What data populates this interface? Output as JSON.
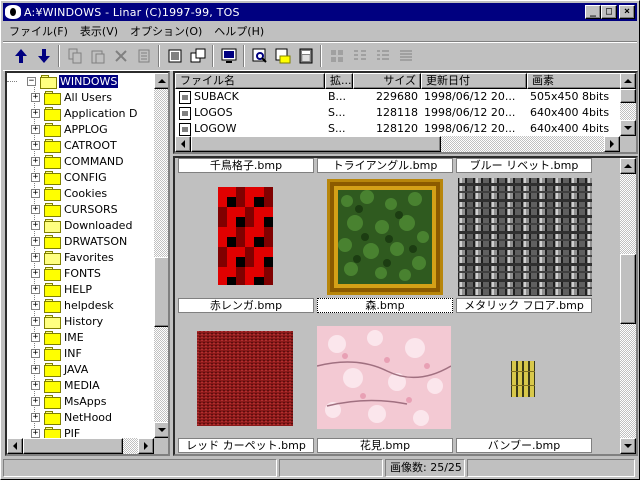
{
  "window": {
    "title": "A:¥WINDOWS - Linar (C)1997-99, TOS",
    "minimize": "_",
    "maximize": "□",
    "close": "×"
  },
  "menu": [
    {
      "label": "ファイル(F)"
    },
    {
      "label": "表示(V)"
    },
    {
      "label": "オプション(O)"
    },
    {
      "label": "ヘルプ(H)"
    }
  ],
  "toolbar": {
    "buttons": [
      {
        "name": "up-arrow-icon",
        "enabled": true
      },
      {
        "name": "down-arrow-icon",
        "enabled": true
      },
      {
        "name": "copy-icon",
        "enabled": false
      },
      {
        "name": "paste-icon",
        "enabled": false
      },
      {
        "name": "delete-icon",
        "enabled": false
      },
      {
        "name": "properties-icon",
        "enabled": false
      },
      {
        "name": "refresh-icon",
        "enabled": true
      },
      {
        "name": "new-window-icon",
        "enabled": true
      },
      {
        "name": "view-icon",
        "enabled": true
      },
      {
        "name": "find-icon",
        "enabled": true
      },
      {
        "name": "open-folder-icon",
        "enabled": true
      },
      {
        "name": "calculator-icon",
        "enabled": true
      },
      {
        "name": "large-icons-view-icon",
        "enabled": false
      },
      {
        "name": "small-icons-view-icon",
        "enabled": false
      },
      {
        "name": "list-view-icon",
        "enabled": false
      },
      {
        "name": "details-view-icon",
        "enabled": false
      }
    ]
  },
  "tree": {
    "root": "WINDOWS",
    "items": [
      {
        "label": "All Users",
        "icon": "folder"
      },
      {
        "label": "Application D",
        "icon": "folder"
      },
      {
        "label": "APPLOG",
        "icon": "folder"
      },
      {
        "label": "CATROOT",
        "icon": "folder"
      },
      {
        "label": "COMMAND",
        "icon": "folder"
      },
      {
        "label": "CONFIG",
        "icon": "folder"
      },
      {
        "label": "Cookies",
        "icon": "folder"
      },
      {
        "label": "CURSORS",
        "icon": "folder"
      },
      {
        "label": "Downloaded",
        "icon": "folder-special"
      },
      {
        "label": "DRWATSON",
        "icon": "folder"
      },
      {
        "label": "Favorites",
        "icon": "folder-special"
      },
      {
        "label": "FONTS",
        "icon": "folder"
      },
      {
        "label": "HELP",
        "icon": "folder"
      },
      {
        "label": "helpdesk",
        "icon": "folder"
      },
      {
        "label": "History",
        "icon": "folder-special"
      },
      {
        "label": "IME",
        "icon": "folder"
      },
      {
        "label": "INF",
        "icon": "folder"
      },
      {
        "label": "JAVA",
        "icon": "folder"
      },
      {
        "label": "MEDIA",
        "icon": "folder"
      },
      {
        "label": "MsApps",
        "icon": "folder"
      },
      {
        "label": "NetHood",
        "icon": "folder"
      },
      {
        "label": "PIF",
        "icon": "folder"
      }
    ]
  },
  "file_list": {
    "columns": [
      "ファイル名",
      "拡...",
      "サイズ",
      "更新日付",
      "画素"
    ],
    "rows": [
      {
        "name": "SUBACK",
        "ext": "B...",
        "size": "229680",
        "date": "1998/06/12 20...",
        "pixels": "505x450 8bits"
      },
      {
        "name": "LOGOS",
        "ext": "S...",
        "size": "128118",
        "date": "1998/06/12 20...",
        "pixels": "640x400 4bits"
      },
      {
        "name": "LOGOW",
        "ext": "S...",
        "size": "128120",
        "date": "1998/06/12 20...",
        "pixels": "640x400 4bits"
      }
    ]
  },
  "gallery": {
    "top_captions": [
      "千鳥格子.bmp",
      "トライアングル.bmp",
      "ブルー リベット.bmp"
    ],
    "items": [
      {
        "caption": "赤レンガ.bmp",
        "selected": false
      },
      {
        "caption": "森.bmp",
        "selected": true
      },
      {
        "caption": "メタリック フロア.bmp",
        "selected": false
      },
      {
        "caption": "レッド カーペット.bmp",
        "selected": false
      },
      {
        "caption": "花見.bmp",
        "selected": false
      },
      {
        "caption": "バンブー.bmp",
        "selected": false
      }
    ]
  },
  "status": {
    "pane1": "",
    "pane2": "",
    "image_count": "画像数: 25/25"
  },
  "colors": {
    "titlebar": "#000080",
    "selection": "#000080",
    "face": "#c0c0c0"
  }
}
